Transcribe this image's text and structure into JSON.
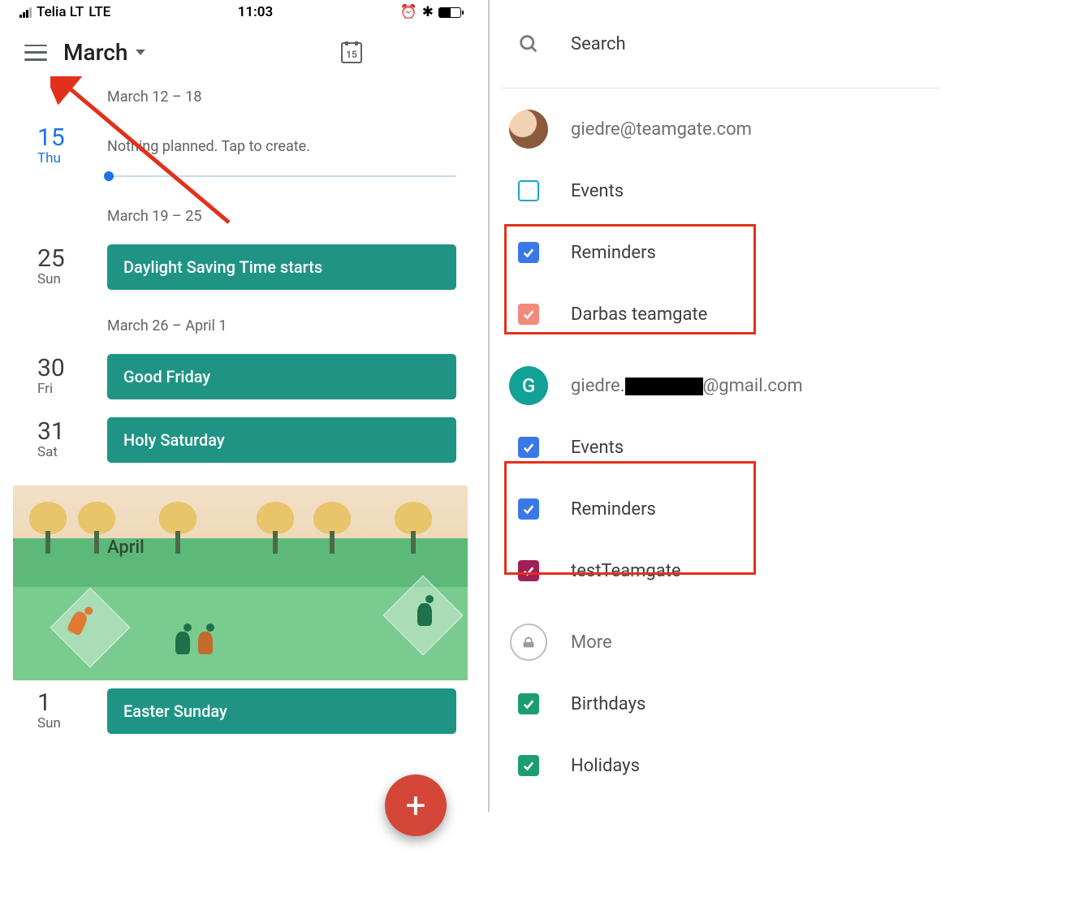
{
  "statusbar": {
    "carrier": "Telia LT",
    "network": "LTE",
    "time": "11:03"
  },
  "header": {
    "month_label": "March",
    "today_day": "15"
  },
  "agenda": {
    "week1_label": "March 12 – 18",
    "today_num": "15",
    "today_name": "Thu",
    "today_empty": "Nothing planned. Tap to create.",
    "week2_label": "March 19 – 25",
    "d25_num": "25",
    "d25_name": "Sun",
    "d25_event": "Daylight Saving Time starts",
    "week3_label": "March 26 – April 1",
    "d30_num": "30",
    "d30_name": "Fri",
    "d30_event": "Good Friday",
    "d31_num": "31",
    "d31_name": "Sat",
    "d31_event": "Holy Saturday",
    "april_label": "April",
    "d1_num": "1",
    "d1_name": "Sun",
    "d1_event": "Easter Sunday"
  },
  "drawer": {
    "search_label": "Search",
    "acct1_email": "giedre@teamgate.com",
    "acct1_events": "Events",
    "acct1_reminders": "Reminders",
    "acct1_cal1": "Darbas teamgate",
    "acct2_initial": "G",
    "acct2_email_pre": "giedre.",
    "acct2_email_post": "@gmail.com",
    "acct2_events": "Events",
    "acct2_reminders": "Reminders",
    "acct2_cal1": "testTeamgate",
    "more_label": "More",
    "birthdays": "Birthdays",
    "holidays": "Holidays"
  }
}
